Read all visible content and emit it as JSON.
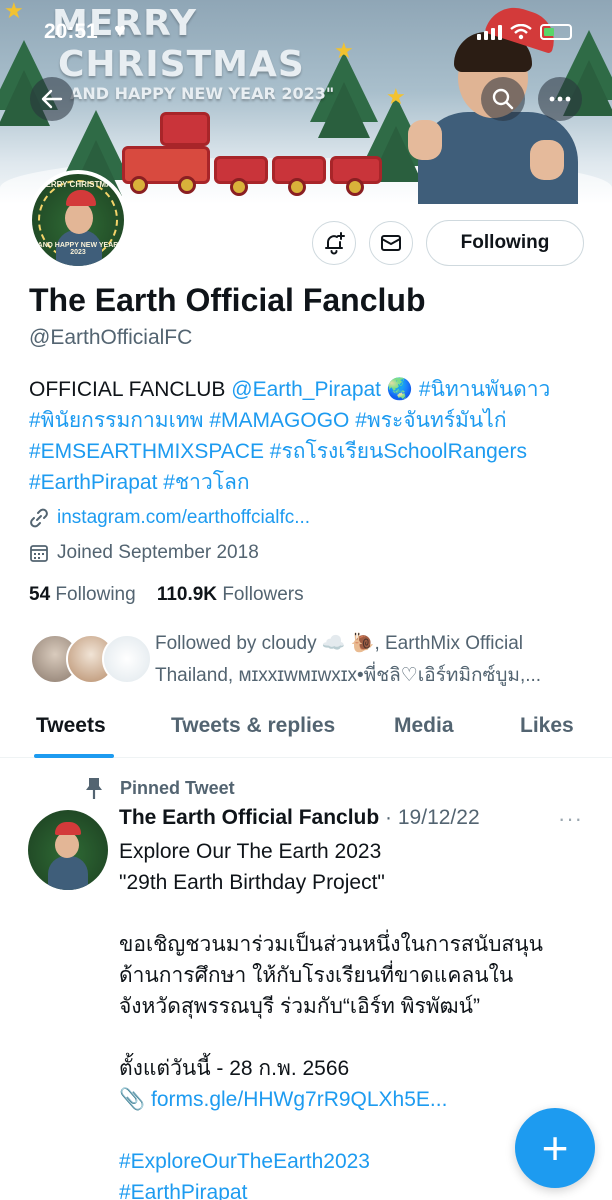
{
  "status_bar": {
    "time": "20:51",
    "heart": "♥"
  },
  "banner": {
    "line1": "MERRY",
    "line2": "CHRISTMAS",
    "line3": "AND HAPPY NEW YEAR 2023\""
  },
  "avatar": {
    "top_text": "MERRY CHRISTMAS",
    "bottom_text": "AND HAPPY NEW YEAR 2023"
  },
  "profile": {
    "follow_button_label": "Following",
    "name": "The Earth Official Fanclub",
    "handle": "@EarthOfficialFC",
    "bio_prefix": "OFFICIAL FANCLUB",
    "bio_mention": "@Earth_Pirapat",
    "bio_emoji": "🌏",
    "bio_tags_line1": "#นิทานพันดาว",
    "bio_tags_line2": "#พินัยกรรมกามเทพ #MAMAGOGO #พระจันทร์มันไก่",
    "bio_tags_line3": "#EMSEARTHMIXSPACE #รถโรงเรียนSchoolRangers",
    "bio_tags_line4": "#EarthPirapat #ชาวโลก",
    "website": "instagram.com/earthoffcialfc...",
    "joined": "Joined September 2018",
    "following_count": "54",
    "following_label": "Following",
    "followers_count": "110.9K",
    "followers_label": "Followers",
    "followed_by_line1": "Followed by cloudy ☁️ 🐌, EarthMix Official",
    "followed_by_line2": "Thailand, ᴍɪxxɪᴡᴍɪᴡxɪx•พี่ชลิ♡เอิร์ทมิกซ์บูม,..."
  },
  "tabs": [
    {
      "label": "Tweets",
      "active": true
    },
    {
      "label": "Tweets & replies",
      "active": false
    },
    {
      "label": "Media",
      "active": false
    },
    {
      "label": "Likes",
      "active": false
    }
  ],
  "pinned_tweet": {
    "pinned_label": "Pinned Tweet",
    "author": "The Earth Official Fanclub",
    "date": "· 19/12/22",
    "more": "···",
    "line1": "Explore Our The Earth 2023",
    "line2": "\"29th Earth Birthday Project\"",
    "line3": "ขอเชิญชวนมาร่วมเป็นส่วนหนึ่งในการสนับสนุน",
    "line4": "ด้านการศึกษา ให้กับโรงเรียนที่ขาดแคลนใน",
    "line5": "จังหวัดสุพรรณบุรี ร่วมกับ“เอิร์ท พิรพัฒน์”",
    "line6": "ตั้งแต่วันนี้ - 28 ก.พ. 2566",
    "link_emoji": "📎",
    "link": "forms.gle/HHWg7rR9QLXh5E...",
    "hashtag1": "#ExploreOurTheEarth2023",
    "hashtag2": "#EarthPirapat"
  },
  "fab": {
    "label": "+"
  },
  "colors": {
    "accent": "#1d9bf0",
    "text": "#0f1419",
    "secondary": "#536471"
  }
}
